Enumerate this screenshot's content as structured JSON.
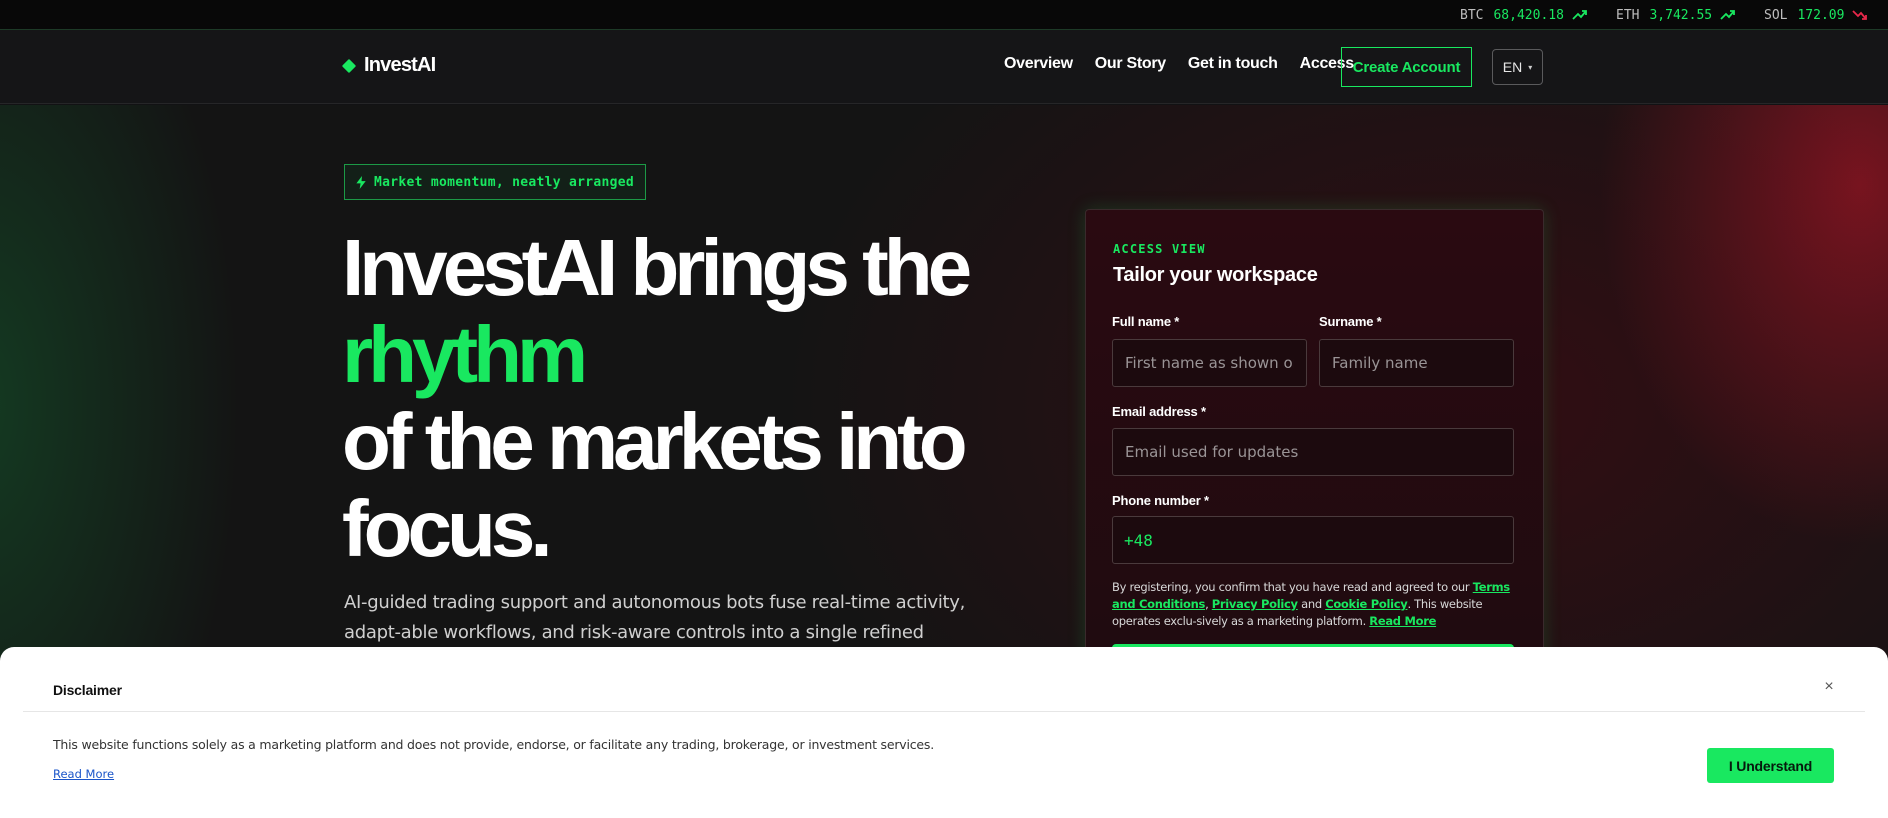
{
  "ticker": [
    {
      "symbol": "BTC",
      "value": "68,420.18",
      "trend": "up"
    },
    {
      "symbol": "ETH",
      "value": "3,742.55",
      "trend": "up"
    },
    {
      "symbol": "SOL",
      "value": "172.09",
      "trend": "down"
    }
  ],
  "nav": {
    "brand": "InvestAI",
    "links": [
      "Overview",
      "Our Story",
      "Get in touch",
      "Access"
    ],
    "create_account": "Create Account",
    "language": "EN"
  },
  "hero": {
    "badge": "Market momentum, neatly arranged",
    "headline_1": "InvestAI brings the",
    "headline_accent": "rhythm",
    "headline_2": "of the markets into",
    "headline_3": "focus.",
    "subtext": "AI-guided trading support and autonomous bots fuse real-time activity, adapt-able workflows, and risk-aware controls into a single refined workspace. Join a"
  },
  "form": {
    "kicker": "ACCESS VIEW",
    "title": "Tailor your workspace",
    "full_name_label": "Full name *",
    "full_name_placeholder": "First name as shown on ID",
    "surname_label": "Surname *",
    "surname_placeholder": "Family name",
    "email_label": "Email address *",
    "email_placeholder": "Email used for updates",
    "phone_label": "Phone number *",
    "phone_prefix": "+48",
    "terms_prefix": "By registering, you confirm that you have read and agreed to our ",
    "terms_link": "Terms and Conditions",
    "terms_comma": ", ",
    "privacy_link": "Privacy Policy",
    "terms_and": " and ",
    "cookie_link": "Cookie Policy",
    "terms_suffix": ". This website operates exclu-sively as a marketing platform. ",
    "read_more": "Read More"
  },
  "disclaimer": {
    "title": "Disclaimer",
    "close": "×",
    "text": "This website functions solely as a marketing platform and does not provide, endorse, or facilitate any trading, brokerage, or investment services.",
    "read_more": "Read More",
    "button": "I Understand"
  },
  "colors": {
    "accent": "#19e860",
    "down": "#e8284a",
    "background": "#141414"
  }
}
